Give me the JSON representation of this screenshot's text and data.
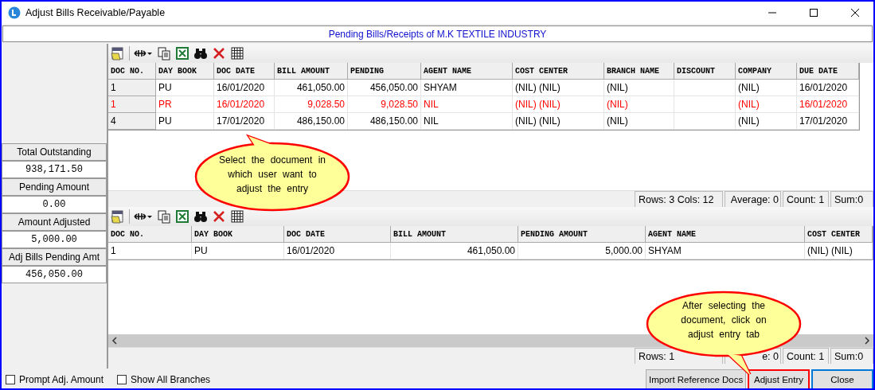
{
  "window": {
    "title": "Adjust Bills Receivable/Payable"
  },
  "header": "Pending Bills/Receipts of M.K TEXTILE INDUSTRY",
  "summary": [
    {
      "label": "Total Outstanding",
      "value": "938,171.50"
    },
    {
      "label": "Pending Amount",
      "value": "0.00"
    },
    {
      "label": "Amount Adjusted",
      "value": "5,000.00"
    },
    {
      "label": "Adj Bills Pending Amt",
      "value": "456,050.00"
    }
  ],
  "pending_table": {
    "columns": [
      {
        "label": "DOC NO.",
        "kind": "text"
      },
      {
        "label": "DAY BOOK",
        "kind": "text"
      },
      {
        "label": "DOC DATE",
        "kind": "text"
      },
      {
        "label": "BILL AMOUNT",
        "kind": "amount"
      },
      {
        "label": "PENDING",
        "kind": "amount"
      },
      {
        "label": "AGENT NAME",
        "kind": "text"
      },
      {
        "label": "COST CENTER",
        "kind": "text"
      },
      {
        "label": "BRANCH NAME",
        "kind": "text"
      },
      {
        "label": "DISCOUNT",
        "kind": "text"
      },
      {
        "label": "COMPANY",
        "kind": "text"
      },
      {
        "label": "DUE DATE",
        "kind": "text"
      }
    ],
    "rows": [
      {
        "color": "#000000",
        "cells": [
          "1",
          "PU",
          "16/01/2020",
          "461,050.00",
          "456,050.00",
          "SHYAM",
          "(NIL) (NIL)",
          "(NIL)",
          null,
          "(NIL)",
          "16/01/2020"
        ]
      },
      {
        "color": "#ff0000",
        "cells": [
          "1",
          "PR",
          "16/01/2020",
          "9,028.50",
          "9,028.50",
          "NIL",
          "(NIL) (NIL)",
          "(NIL)",
          null,
          "(NIL)",
          "16/01/2020"
        ]
      },
      {
        "color": "#000000",
        "cells": [
          "4",
          "PU",
          "17/01/2020",
          "486,150.00",
          "486,150.00",
          "NIL",
          "(NIL) (NIL)",
          "(NIL)",
          null,
          "(NIL)",
          "17/01/2020"
        ]
      }
    ],
    "status_bar": [
      "Rows: 3  Cols: 12",
      "Average: 0",
      "Count: 1",
      "Sum:0"
    ]
  },
  "adjusted_table": {
    "columns": [
      {
        "label": "DOC NO.",
        "kind": "text"
      },
      {
        "label": "DAY BOOK",
        "kind": "text"
      },
      {
        "label": "DOC DATE",
        "kind": "text"
      },
      {
        "label": "BILL AMOUNT",
        "kind": "amount"
      },
      {
        "label": "PENDING AMOUNT",
        "kind": "amount"
      },
      {
        "label": "AGENT NAME",
        "kind": "text"
      },
      {
        "label": "COST CENTER",
        "kind": "text"
      }
    ],
    "rows": [
      {
        "color": "#000000",
        "cells": [
          "1",
          "PU",
          "16/01/2020",
          "461,050.00",
          "5,000.00",
          "SHYAM",
          "(NIL) (NIL)"
        ]
      }
    ],
    "status_bar": [
      "Rows: 1",
      "e: 0",
      "Count: 1",
      "Sum:0"
    ]
  },
  "options": [
    {
      "label": "Prompt Adj. Amount",
      "checked": false
    },
    {
      "label": "Show All Branches",
      "checked": false
    }
  ],
  "buttons": [
    {
      "label": "Import Reference Docs",
      "highlighted": false,
      "default": false
    },
    {
      "label": "Adjust Entry",
      "highlighted": true,
      "default": false
    },
    {
      "label": "Close",
      "highlighted": false,
      "default": true
    }
  ],
  "callouts": [
    {
      "text": "Select the document in which user want to adjust the entry"
    },
    {
      "text": "After selecting the document, click on adjust entry tab"
    }
  ]
}
